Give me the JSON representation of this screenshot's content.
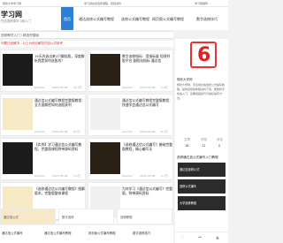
{
  "topbar": {
    "left": "规欢大学学习网",
    "middle": "学习通在线选修课程，视频资料",
    "right": "学习网推荐..."
  },
  "header": {
    "logo_title": "学习网",
    "logo_sub": "在线选修课学习网入门",
    "nav_active": "首页",
    "nav_items": [
      "通达选修公式编写教程",
      "选修公式编写教程",
      "网页版公式编写教程",
      "数字选修技巧"
    ]
  },
  "breadcrumb": "选修教材入门 / 精选完整版",
  "notice": "问题已经解决，以上为综合解答内容以供参考",
  "articles": [
    {
      "title": "19天内选出来2只翻倍股，深度解析我是如何选股的！",
      "author": "zhumilu",
      "date": "2023-05-06",
      "views": "12.2万"
    },
    {
      "title": "数字选修指标：用指标量 短线抄股平台 副股站指标 通达信",
      "author": "zhumilu",
      "date": "2023-05-06",
      "views": "1.8万"
    },
    {
      "title": "通达信公式编写教程完整版教程：全方面解密如何选股获利",
      "author": "zhumilu",
      "date": "2023-05-06",
      "views": "8.5万"
    },
    {
      "title": "通达信公式编写教程完整版教程：快速学会通达信公式编写",
      "author": "zhumilu",
      "date": "2023-05-06",
      "views": "6.3万"
    },
    {
      "title": "【实例】学习通达信公式编写教程，完整版课程附带源码资料",
      "author": "zhumilu",
      "date": "2023-05-06",
      "views": "3.1万"
    },
    {
      "title": "《选修通达信公式编写》基础完整版教程，精心编写无",
      "author": "zhumilu",
      "date": "2023-05-06",
      "views": "2.7万"
    },
    {
      "title": "《选修通达信公式编写教程》图解版本，完整版整体课程",
      "author": "zhumilu",
      "date": "2023-05-06",
      "views": "9.9万"
    },
    {
      "title": "为何学习《通达信公式编写》完整版，附带源码资料",
      "author": "zhumilu",
      "date": "2023-05-06",
      "views": "4.4万"
    }
  ],
  "bottom_cards": [
    "通达信公式",
    "数字选修",
    "选修教程"
  ],
  "sidebar": {
    "name": "规欢大学网",
    "desc": "规欢大学网，专注通达信选修公式编写教程，提供完整版教程资料下载，帮助新手快速入门，掌握选股技巧与指标编写方法。",
    "stats": [
      {
        "label": "文章",
        "value": "18"
      },
      {
        "label": "浏览",
        "value": "12"
      },
      {
        "label": "评论",
        "value": "0"
      }
    ],
    "section_title": "选修通达信公式编写入门教程",
    "pics": [
      "通达信选修公式",
      "选修公式编写",
      "大学选修教程"
    ]
  },
  "footer": {
    "links": [
      "通达信公式编写",
      "通达信公式编写教程",
      "网页版公式编写教程",
      "数字选修技巧"
    ]
  },
  "colors": {
    "accent": "#2b7fd4",
    "notice": "#d33333",
    "logo_red": "#dd2222"
  }
}
